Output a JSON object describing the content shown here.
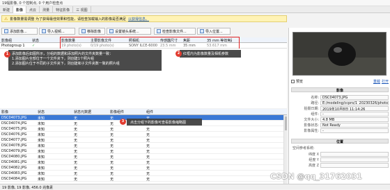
{
  "topbar": {
    "text": "19幅影像, 0 个控制点, 0 个用户检查点"
  },
  "tabs": [
    {
      "label": "新建"
    },
    {
      "label": "影像"
    },
    {
      "label": "点云"
    },
    {
      "label": "测量"
    },
    {
      "label": "特征影像"
    },
    {
      "label": "三 视图"
    }
  ],
  "warning": {
    "text": "影像数量需调整 为了获得最佳效果和性能，请检查加载输入的影像是否满足",
    "link": "以获得信息。"
  },
  "toolbar": [
    "添加影像...",
    "导入视频...",
    "移除影像",
    "设置镜头系统...",
    "检查影像文件...",
    "导入位置..."
  ],
  "grid": {
    "headers": [
      "影像组",
      "状态",
      "影像数量",
      "主要影像文件",
      "照相机",
      "传感器尺寸",
      "焦距",
      "35 mm 等效焦距"
    ],
    "row": [
      "Photogroup 1",
      "✓",
      "19 photo(s)",
      "0/19 photo(s)",
      "SONY ILCE-6000",
      "23.5 mm",
      "35 mm",
      "53.617 mm"
    ]
  },
  "notes": {
    "n1": "添加影像后如图所示，分组的数据和添加照片的文件夹数量一致：\n1.添加图片全部位于一个文件夹下，则创建1个照片组\n2.添加图片位于不同的子文件夹下，则创建和子文件夹数一致的照片组",
    "n2": "红框内为影像数量及相机参数",
    "n3": "点击分组下的影像可查看影像缩略图"
  },
  "badges": [
    "1",
    "2",
    "3"
  ],
  "list": {
    "headers": [
      "影像",
      "状态",
      "状态元数据",
      "影像组件",
      "组件"
    ],
    "rows": [
      [
        "DSC04073.JPG",
        "未知",
        "无",
        "无",
        "无"
      ],
      [
        "DSC04074.JPG",
        "未知",
        "无",
        "无",
        "无"
      ],
      [
        "DSC04075.JPG",
        "未知",
        "无",
        "无",
        "无"
      ],
      [
        "DSC04076.JPG",
        "未知",
        "无",
        "无",
        "无"
      ],
      [
        "DSC04077.JPG",
        "未知",
        "无",
        "无",
        "无"
      ],
      [
        "DSC04078.JPG",
        "未知",
        "无",
        "无",
        "无"
      ],
      [
        "DSC04079.JPG",
        "未知",
        "无",
        "无",
        "无"
      ],
      [
        "DSC04080.JPG",
        "未知",
        "无",
        "无",
        "无"
      ],
      [
        "DSC04081.JPG",
        "未知",
        "无",
        "无",
        "无"
      ],
      [
        "DSC04082.JPG",
        "未知",
        "无",
        "无",
        "无"
      ],
      [
        "DSC04083.JPG",
        "未知",
        "无",
        "无",
        "无"
      ],
      [
        "DSC04084.JPG",
        "未知",
        "无",
        "无",
        "无"
      ]
    ]
  },
  "status": "19 影像, 19 影像, 456.0 兆像素",
  "right": {
    "preview_check": "预览",
    "links": [
      "重载",
      "打开"
    ],
    "section_image": "影像",
    "fields": [
      {
        "k": "名称:",
        "v": "DSC04073.JPG"
      },
      {
        "k": "路径:",
        "v": "E:/modeling/ccpro/1_20230326/photo"
      },
      {
        "k": "拍摄日期:",
        "v": "2019年10月8日 11:14:26"
      },
      {
        "k": "组件:",
        "v": "-"
      },
      {
        "k": "文件大小:",
        "v": "4.8 MB"
      },
      {
        "k": "影像状态:",
        "v": "Not Ready"
      },
      {
        "k": "影像属性:",
        "v": "-"
      }
    ],
    "section_pos": "位置",
    "pos_label": "空间参考系统:",
    "pos_fields": [
      {
        "k": "纬度 X",
        "v": ""
      },
      {
        "k": "经度 Y",
        "v": ""
      },
      {
        "k": "高度 Z",
        "v": ""
      }
    ]
  },
  "watermark": "CSDN @qq_31762031"
}
